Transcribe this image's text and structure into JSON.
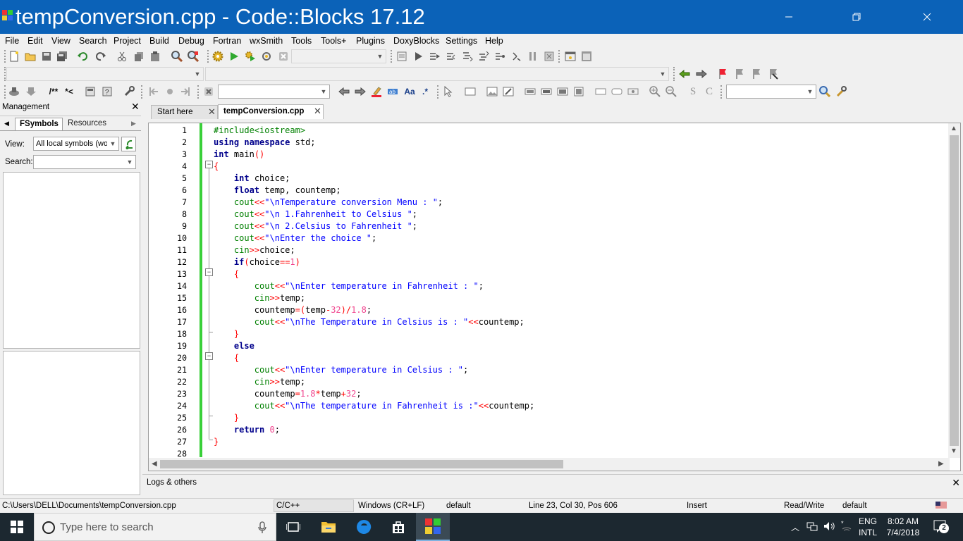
{
  "window": {
    "title": "tempConversion.cpp - Code::Blocks 17.12",
    "controls": [
      "minimize",
      "restore",
      "close"
    ]
  },
  "menu": [
    "File",
    "Edit",
    "View",
    "Search",
    "Project",
    "Build",
    "Debug",
    "Fortran",
    "wxSmith",
    "Tools",
    "Tools+",
    "Plugins",
    "DoxyBlocks",
    "Settings",
    "Help"
  ],
  "toolbar": {
    "comment_label": "/**",
    "uncomment_label": "*<",
    "regex_label": ".*",
    "s_label": "S",
    "c_label": "C"
  },
  "management": {
    "title": "Management",
    "tabs": [
      "FSymbols",
      "Resources"
    ],
    "view_label": "View:",
    "view_value": "All local symbols (wor",
    "search_label": "Search:",
    "search_value": ""
  },
  "editor": {
    "tabs": [
      {
        "label": "Start here",
        "active": false
      },
      {
        "label": "tempConversion.cpp",
        "active": true
      }
    ],
    "lines": [
      "#include<iostream>",
      "using namespace std;",
      "int main()",
      "{",
      "    int choice;",
      "    float temp, countemp;",
      "    cout<<\"\\nTemperature conversion Menu : \";",
      "    cout<<\"\\n 1.Fahrenheit to Celsius \";",
      "    cout<<\"\\n 2.Celsius to Fahrenheit \";",
      "    cout<<\"\\nEnter the choice \";",
      "    cin>>choice;",
      "    if(choice==1)",
      "    {",
      "        cout<<\"\\nEnter temperature in Fahrenheit : \";",
      "        cin>>temp;",
      "        countemp=(temp-32)/1.8;",
      "        cout<<\"\\nThe Temperature in Celsius is : \"<<countemp;",
      "    }",
      "    else",
      "    {",
      "        cout<<\"\\nEnter temperature in Celsius : \";",
      "        cin>>temp;",
      "        countemp=1.8*temp+32;",
      "        cout<<\"\\nThe temperature in Fahrenheit is :\"<<countemp;",
      "    }",
      "    return 0;",
      "}",
      ""
    ],
    "line_numbers": [
      "1",
      "2",
      "3",
      "4",
      "5",
      "6",
      "7",
      "8",
      "9",
      "10",
      "11",
      "12",
      "13",
      "14",
      "15",
      "16",
      "17",
      "18",
      "19",
      "20",
      "21",
      "22",
      "23",
      "24",
      "25",
      "26",
      "27",
      "28"
    ]
  },
  "logs": {
    "title": "Logs & others"
  },
  "status": {
    "path": "C:\\Users\\DELL\\Documents\\tempConversion.cpp",
    "language": "C/C++",
    "eol": "Windows (CR+LF)",
    "encoding": "default",
    "position": "Line 23, Col 30, Pos 606",
    "mode": "Insert",
    "access": "Read/Write",
    "style": "default"
  },
  "taskbar": {
    "search_placeholder": "Type here to search",
    "lang_top": "ENG",
    "lang_bottom": "INTL",
    "time": "8:02 AM",
    "date": "7/4/2018",
    "notifications": "2"
  },
  "colors": {
    "titlebar": "#0b62b8",
    "keyword": "#00008b",
    "preprocessor": "#008000",
    "string": "#0000ff",
    "operator": "#ff0000",
    "number": "#f0458e",
    "change_bar": "#39d039"
  }
}
